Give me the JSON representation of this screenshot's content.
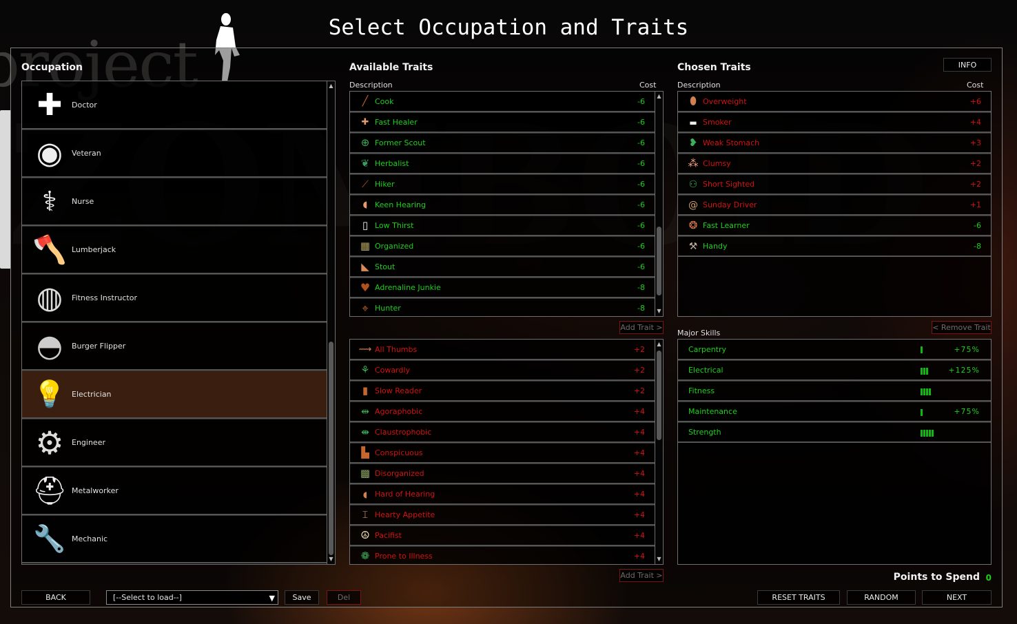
{
  "window": {
    "title": "Select Occupation and Traits",
    "logo_text_top": "project",
    "logo_text_bottom": "ZOMBOID"
  },
  "colors": {
    "positive_green": "#19d319",
    "negative_red": "#d61010",
    "selected_row": "#3a1e10"
  },
  "occupation": {
    "heading": "Occupation",
    "selected": "Electrician",
    "scroll_position": 1.0,
    "items": [
      {
        "label": "Doctor",
        "icon": "medical-cross-icon"
      },
      {
        "label": "Veteran",
        "icon": "veteran-seal-icon"
      },
      {
        "label": "Nurse",
        "icon": "nurse-badge-icon"
      },
      {
        "label": "Lumberjack",
        "icon": "axe-icon"
      },
      {
        "label": "Fitness Instructor",
        "icon": "sweatband-icon"
      },
      {
        "label": "Burger Flipper",
        "icon": "burger-icon"
      },
      {
        "label": "Electrician",
        "icon": "light-bulb-icon"
      },
      {
        "label": "Engineer",
        "icon": "gears-icon"
      },
      {
        "label": "Metalworker",
        "icon": "welding-mask-icon"
      },
      {
        "label": "Mechanic",
        "icon": "wrench-icon"
      }
    ]
  },
  "available_traits": {
    "heading": "Available Traits",
    "col_description": "Description",
    "col_cost": "Cost",
    "add_trait_label": "Add Trait >",
    "positive": [
      {
        "label": "Cook",
        "cost": "-6",
        "icon": "spoon-icon"
      },
      {
        "label": "Fast Healer",
        "cost": "-6",
        "icon": "bandage-icon"
      },
      {
        "label": "Former Scout",
        "cost": "-6",
        "icon": "scout-badge-icon"
      },
      {
        "label": "Herbalist",
        "cost": "-6",
        "icon": "leaf-icon"
      },
      {
        "label": "Hiker",
        "cost": "-6",
        "icon": "walking-stick-icon"
      },
      {
        "label": "Keen Hearing",
        "cost": "-6",
        "icon": "ear-icon"
      },
      {
        "label": "Low Thirst",
        "cost": "-6",
        "icon": "glass-icon"
      },
      {
        "label": "Organized",
        "cost": "-6",
        "icon": "organized-icon"
      },
      {
        "label": "Stout",
        "cost": "-6",
        "icon": "bicep-icon"
      },
      {
        "label": "Adrenaline Junkie",
        "cost": "-8",
        "icon": "heart-alert-icon"
      },
      {
        "label": "Hunter",
        "cost": "-8",
        "icon": "crosshair-icon"
      }
    ],
    "negative": [
      {
        "label": "All Thumbs",
        "cost": "+2",
        "icon": "needle-thread-icon"
      },
      {
        "label": "Cowardly",
        "cost": "+2",
        "icon": "wilted-flower-icon"
      },
      {
        "label": "Slow Reader",
        "cost": "+2",
        "icon": "book-icon"
      },
      {
        "label": "Agoraphobic",
        "cost": "+4",
        "icon": "agoraphobic-icon"
      },
      {
        "label": "Claustrophobic",
        "cost": "+4",
        "icon": "claustrophobic-icon"
      },
      {
        "label": "Conspicuous",
        "cost": "+4",
        "icon": "top-hat-icon"
      },
      {
        "label": "Disorganized",
        "cost": "+4",
        "icon": "disorganized-icon"
      },
      {
        "label": "Hard of Hearing",
        "cost": "+4",
        "icon": "ear-muted-icon"
      },
      {
        "label": "Hearty Appetite",
        "cost": "+4",
        "icon": "apple-core-icon"
      },
      {
        "label": "Pacifist",
        "cost": "+4",
        "icon": "peace-icon"
      },
      {
        "label": "Prone to Illness",
        "cost": "+4",
        "icon": "germ-icon"
      }
    ]
  },
  "chosen_traits": {
    "heading": "Chosen Traits",
    "info_label": "INFO",
    "col_description": "Description",
    "col_cost": "Cost",
    "remove_trait_label": "< Remove Trait",
    "items": [
      {
        "label": "Overweight",
        "cost": "+6",
        "kind": "bad",
        "icon": "belly-icon"
      },
      {
        "label": "Smoker",
        "cost": "+4",
        "kind": "bad",
        "icon": "cigarette-icon"
      },
      {
        "label": "Weak Stomach",
        "cost": "+3",
        "kind": "bad",
        "icon": "stomach-icon"
      },
      {
        "label": "Clumsy",
        "cost": "+2",
        "kind": "bad",
        "icon": "footprints-icon"
      },
      {
        "label": "Short Sighted",
        "cost": "+2",
        "kind": "bad",
        "icon": "glasses-icon"
      },
      {
        "label": "Sunday Driver",
        "cost": "+1",
        "kind": "bad",
        "icon": "snail-icon"
      },
      {
        "label": "Fast Learner",
        "cost": "-6",
        "kind": "good",
        "icon": "brain-icon"
      },
      {
        "label": "Handy",
        "cost": "-8",
        "kind": "good",
        "icon": "hammer-icon"
      }
    ]
  },
  "major_skills": {
    "heading": "Major Skills",
    "items": [
      {
        "label": "Carpentry",
        "level": 1,
        "boost": "+75%"
      },
      {
        "label": "Electrical",
        "level": 3,
        "boost": "+125%"
      },
      {
        "label": "Fitness",
        "level": 4,
        "boost": ""
      },
      {
        "label": "Maintenance",
        "level": 1,
        "boost": "+75%"
      },
      {
        "label": "Strength",
        "level": 5,
        "boost": ""
      }
    ]
  },
  "footer": {
    "back_label": "BACK",
    "load_select_value": "[--Select to load--]",
    "save_label": "Save",
    "del_label": "Del",
    "points_label": "Points to Spend",
    "points_value": "0",
    "reset_label": "RESET TRAITS",
    "random_label": "RANDOM",
    "next_label": "NEXT"
  }
}
